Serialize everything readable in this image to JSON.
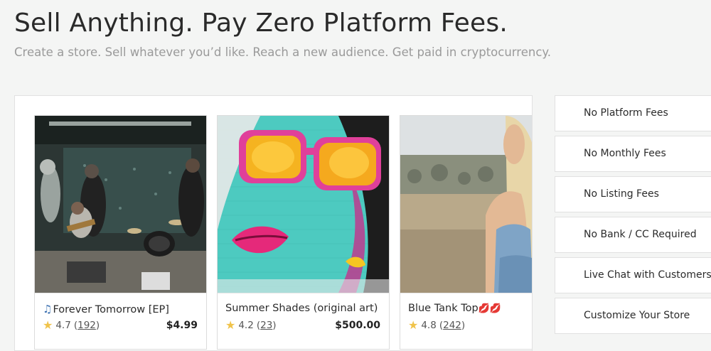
{
  "hero": {
    "headline": "Sell Anything. Pay Zero Platform Fees.",
    "subheadline": "Create a store. Sell whatever you’d like. Reach a new audience. Get paid in cryptocurrency."
  },
  "products": [
    {
      "title": "Forever Tomorrow [EP]",
      "icon": "music-note-icon",
      "rating": "4.7",
      "reviews": "192",
      "price": "$4.99"
    },
    {
      "title": "Summer Shades (original art)",
      "rating": "4.2",
      "reviews": "23",
      "price": "$500.00"
    },
    {
      "title": "Blue Tank Top",
      "icon": "lips-icon",
      "rating": "4.8",
      "reviews": "242",
      "price": ""
    }
  ],
  "features": [
    "No Platform Fees",
    "No Monthly Fees",
    "No Listing Fees",
    "No Bank / CC Required",
    "Live Chat with Customers",
    "Customize Your Store"
  ],
  "colors": {
    "star": "#f0c34a",
    "page_bg": "#f4f5f4"
  }
}
